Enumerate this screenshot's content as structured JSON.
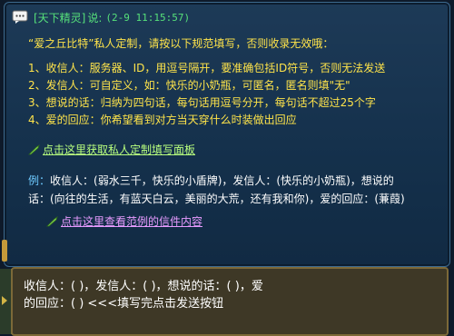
{
  "header": {
    "tag": "[天下精灵]",
    "said": "说:",
    "time": "(2-9 11:15:57)"
  },
  "intro": "“爱之丘比特”私人定制，请按以下规范填写，否则收录无效哦：",
  "rules": [
    "1、收信人：服务器、ID，用逗号隔开，要准确包括ID符号，否则无法发送",
    "2、发信人：可自定义，如：快乐的小奶瓶，可匿名，匿名则填\"无\"",
    "3、想说的话：归纳为四句话，每句话用逗号分开，每句话不超过25个字",
    "4、爱的回应：你希望看到对方当天穿什么时装做出回应"
  ],
  "link_template": "点击这里获取私人定制填写面板",
  "example": {
    "prefix": "例：",
    "line1": "收信人：(弱水三千，快乐的小盾牌)，发信人：(快乐的小奶瓶)，想说的",
    "line2": "话：(向往的生活，有蓝天白云，美丽的大荒，还有我和你)，爱的回应：(蒹葭)"
  },
  "link_example": "点击这里查看范例的信件内容",
  "input": {
    "line1": "收信人：(  )，发信人：(  )，想说的话：(  )，爱",
    "line2": "的回应：(  ) <<<填写完点击发送按钮"
  },
  "colors": {
    "panel": "#1d3a57",
    "header_tag": "#56e07a",
    "header_name": "#e6c24a",
    "rule_text": "#ffe44a",
    "link_green": "#b9ff7e",
    "link_purple": "#e79bff",
    "input_bg": "#3e3826"
  }
}
